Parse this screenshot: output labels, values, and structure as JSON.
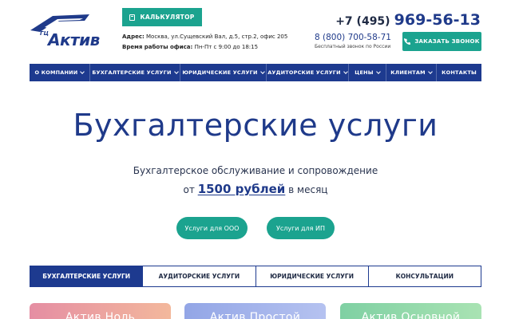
{
  "header": {
    "logo": {
      "small_text": "ГЦ",
      "brand": "Актив"
    },
    "calculator_button": "КАЛЬКУЛЯТОР",
    "address_label": "Адрес:",
    "address_value": "Москва, ул.Сущевский Вал, д.5, стр.2, офис 205",
    "hours_label": "Время работы офиса:",
    "hours_value": "Пн-Пт с 9:00 до 18:15",
    "phone_prefix": "+7 (495)",
    "phone_number": "969-56-13",
    "phone_free": "8 (800) 700-58-71",
    "phone_free_note": "Бесплатный звонок по России",
    "call_button": "ЗАКАЗАТЬ ЗВОНОК"
  },
  "nav": {
    "items": [
      {
        "label": "О КОМПАНИИ",
        "dropdown": true
      },
      {
        "label": "БУХГАЛТЕРСКИЕ УСЛУГИ",
        "dropdown": true
      },
      {
        "label": "ЮРИДИЧЕСКИЕ УСЛУГИ",
        "dropdown": true
      },
      {
        "label": "АУДИТОРСКИЕ УСЛУГИ",
        "dropdown": true
      },
      {
        "label": "ЦЕНЫ",
        "dropdown": true
      },
      {
        "label": "КЛИЕНТАМ",
        "dropdown": true
      },
      {
        "label": "КОНТАКТЫ",
        "dropdown": false
      }
    ]
  },
  "hero": {
    "title": "Бухгалтерские услуги",
    "subtitle": "Бухгалтерское обслуживание и сопровождение",
    "price_prefix": "от",
    "price_amount": "1500 рублей",
    "price_suffix": "в месяц",
    "button_ooo": "Услуги для ООО",
    "button_ip": "Услуги для ИП"
  },
  "tabs": [
    {
      "label": "БУХГАЛТЕРСКИЕ УСЛУГИ",
      "active": true
    },
    {
      "label": "АУДИТОРСКИЕ УСЛУГИ",
      "active": false
    },
    {
      "label": "ЮРИДИЧЕСКИЕ УСЛУГИ",
      "active": false
    },
    {
      "label": "КОНСУЛЬТАЦИИ",
      "active": false
    }
  ],
  "cards": [
    {
      "title": "Актив Ноль"
    },
    {
      "title": "Актив Простой"
    },
    {
      "title": "Актив Основной"
    }
  ],
  "colors": {
    "brand_blue": "#1d3a8f",
    "accent_teal": "#1ba38f"
  },
  "icons": {
    "calculator": "calculator-icon",
    "phone": "phone-icon",
    "chevron": "chevron-down-icon"
  }
}
